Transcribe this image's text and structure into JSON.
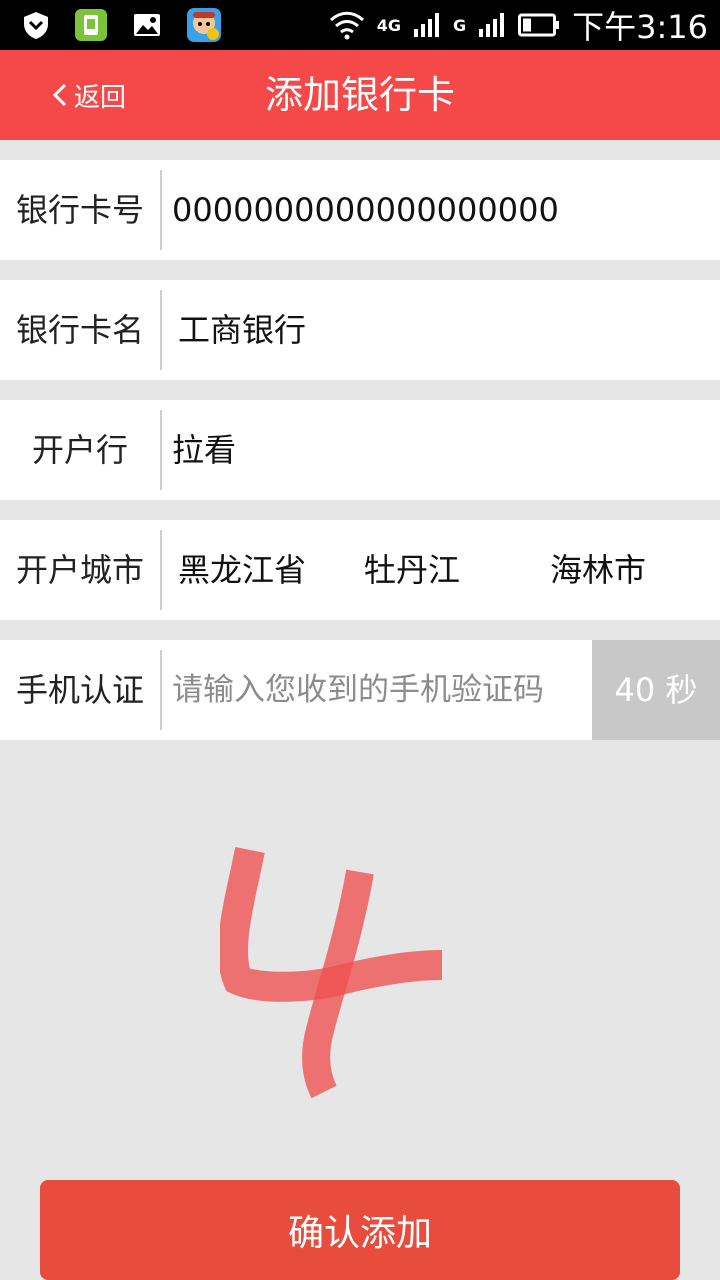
{
  "status_bar": {
    "network_label": "4G",
    "carrier_label": "G",
    "time": "下午3:16"
  },
  "header": {
    "back_label": "返回",
    "title": "添加银行卡"
  },
  "form": {
    "card_number": {
      "label": "银行卡号",
      "value": "0000000000000000000"
    },
    "card_name": {
      "label": "银行卡名",
      "value": "工商银行"
    },
    "bank_branch": {
      "label": "开户行",
      "value": "拉看"
    },
    "city": {
      "label": "开户城市",
      "province": "黑龙江省",
      "city": "牡丹江",
      "district": "海林市"
    },
    "phone_auth": {
      "label": "手机认证",
      "placeholder": "请输入您收到的手机验证码",
      "countdown": "40 秒"
    }
  },
  "confirm_button": "确认添加",
  "colors": {
    "header_bg": "#f54848",
    "button_bg": "#e84c3d",
    "page_bg": "#e6e6e6",
    "countdown_bg": "#c8c8c8",
    "scribble": "#f05050"
  }
}
